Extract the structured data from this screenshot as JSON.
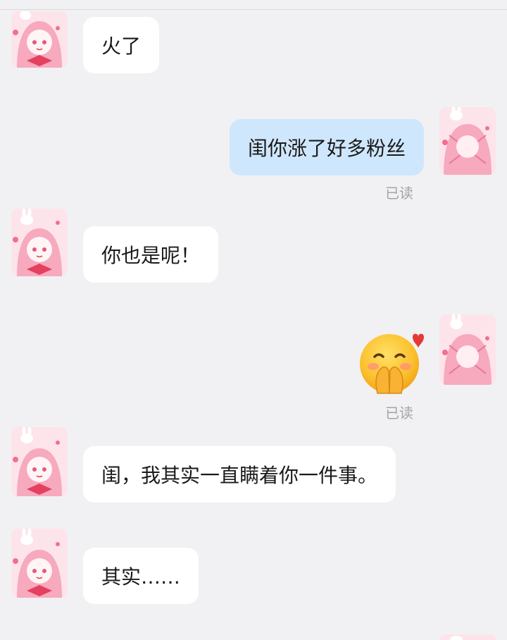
{
  "messages": [
    {
      "side": "left",
      "text": "火了"
    },
    {
      "side": "right",
      "text": "闺你涨了好多粉丝",
      "status": "已读"
    },
    {
      "side": "left",
      "text": "你也是呢！"
    },
    {
      "side": "right",
      "emoji": "blushing-hands-heart-emoji",
      "status": "已读"
    },
    {
      "side": "left",
      "text": "闺，我其实一直瞒着你一件事。"
    },
    {
      "side": "left",
      "text": "其实……"
    }
  ],
  "colors": {
    "background": "#f1f1f3",
    "left_bubble": "#ffffff",
    "right_bubble": "#cfe7fd",
    "read_status": "#a4a4a8",
    "avatar_pink": "#f7a9bd"
  }
}
